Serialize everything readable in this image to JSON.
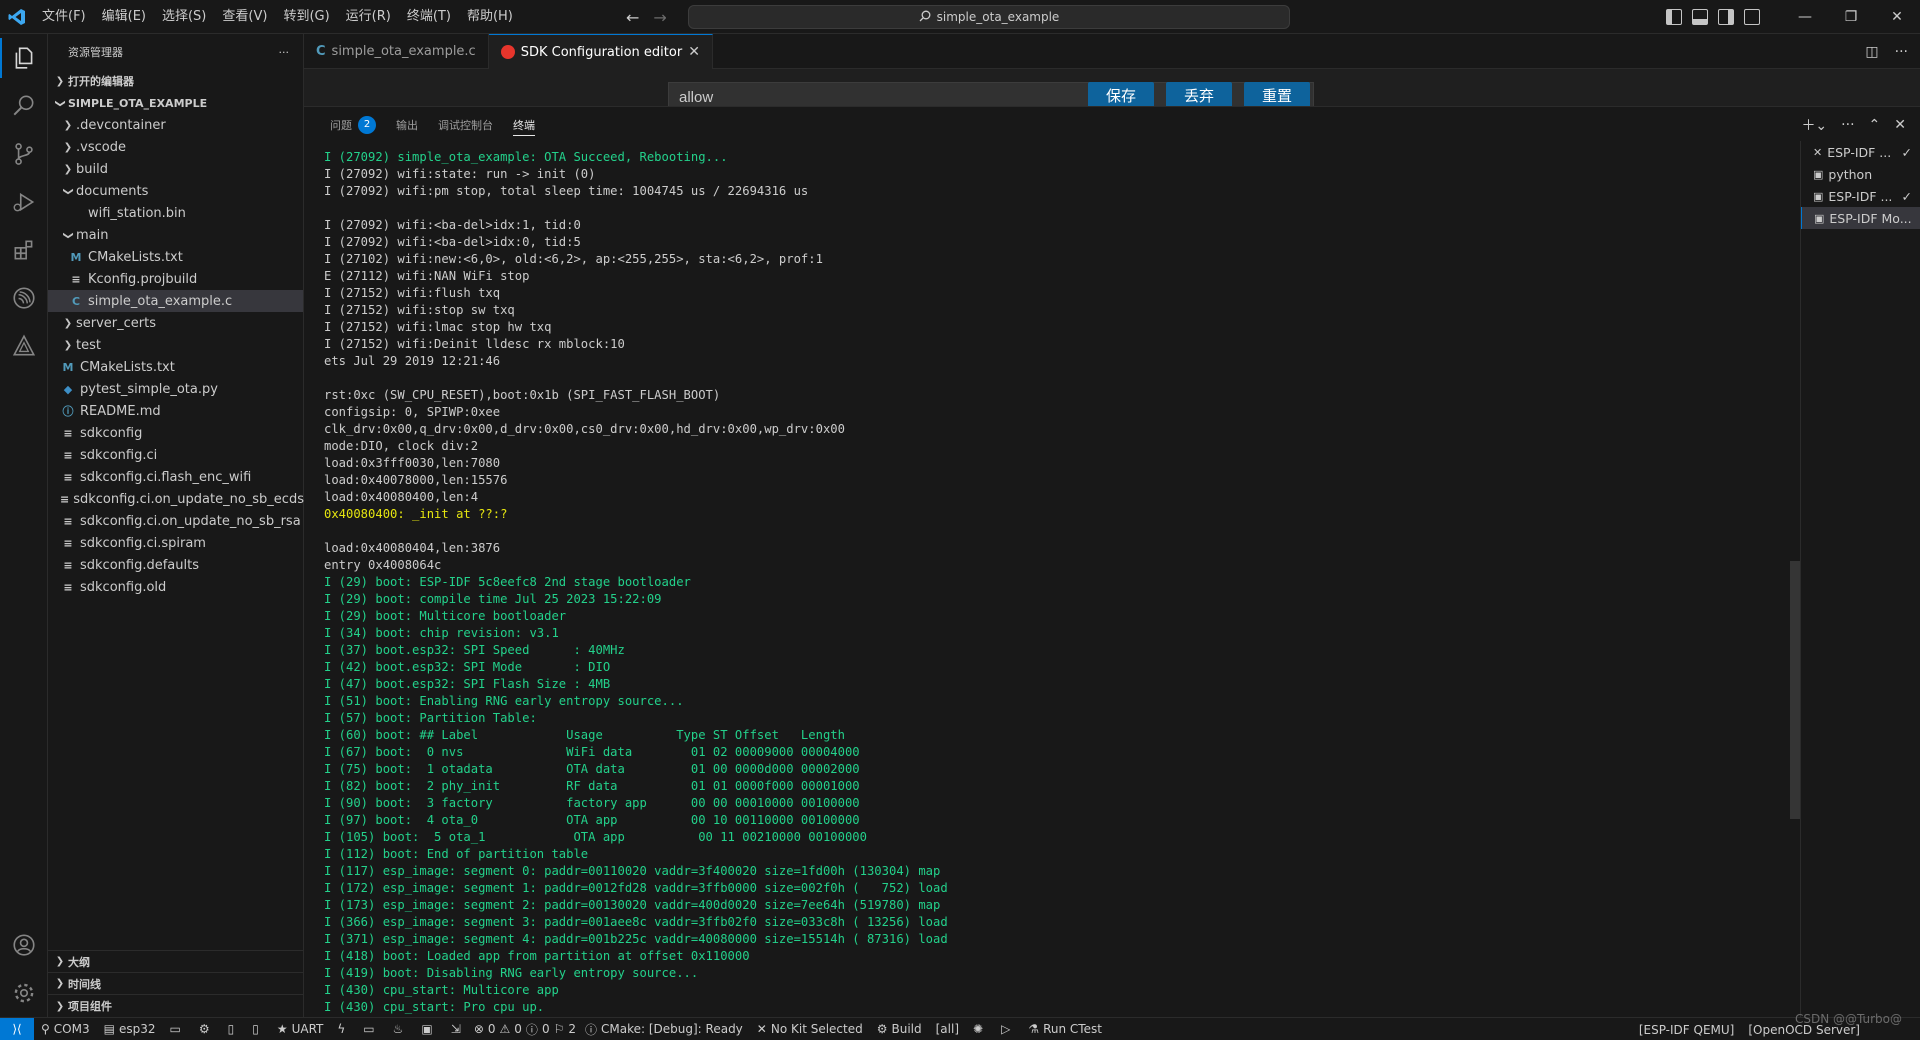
{
  "window": {
    "menu": [
      "文件(F)",
      "编辑(E)",
      "选择(S)",
      "查看(V)",
      "转到(G)",
      "运行(R)",
      "终端(T)",
      "帮助(H)"
    ],
    "search_text": "simple_ota_example"
  },
  "sidebar": {
    "title": "资源管理器",
    "open_editors": "打开的编辑器",
    "project": "SIMPLE_OTA_EXAMPLE",
    "tree": [
      {
        "label": ".devcontainer",
        "icon": "folder-collapsed-icon",
        "indent": 1
      },
      {
        "label": ".vscode",
        "icon": "folder-collapsed-icon",
        "indent": 1
      },
      {
        "label": "build",
        "icon": "folder-collapsed-icon",
        "indent": 1
      },
      {
        "label": "documents",
        "icon": "folder-expanded-icon",
        "indent": 1
      },
      {
        "label": "wifi_station.bin",
        "icon": "file-icon",
        "indent": 2
      },
      {
        "label": "main",
        "icon": "folder-expanded-icon",
        "indent": 1
      },
      {
        "label": "CMakeLists.txt",
        "icon": "cmake-file-icon",
        "indent": 2
      },
      {
        "label": "Kconfig.projbuild",
        "icon": "file-lines-icon",
        "indent": 2
      },
      {
        "label": "simple_ota_example.c",
        "icon": "c-file-icon",
        "indent": 2,
        "selected": true
      },
      {
        "label": "server_certs",
        "icon": "folder-collapsed-icon",
        "indent": 1
      },
      {
        "label": "test",
        "icon": "folder-collapsed-icon",
        "indent": 1
      },
      {
        "label": "CMakeLists.txt",
        "icon": "cmake-file-icon",
        "indent": 1
      },
      {
        "label": "pytest_simple_ota.py",
        "icon": "python-file-icon",
        "indent": 1
      },
      {
        "label": "README.md",
        "icon": "info-file-icon",
        "indent": 1
      },
      {
        "label": "sdkconfig",
        "icon": "file-lines-icon",
        "indent": 1
      },
      {
        "label": "sdkconfig.ci",
        "icon": "file-lines-icon",
        "indent": 1
      },
      {
        "label": "sdkconfig.ci.flash_enc_wifi",
        "icon": "file-lines-icon",
        "indent": 1
      },
      {
        "label": "sdkconfig.ci.on_update_no_sb_ecdsa",
        "icon": "file-lines-icon",
        "indent": 1
      },
      {
        "label": "sdkconfig.ci.on_update_no_sb_rsa",
        "icon": "file-lines-icon",
        "indent": 1
      },
      {
        "label": "sdkconfig.ci.spiram",
        "icon": "file-lines-icon",
        "indent": 1
      },
      {
        "label": "sdkconfig.defaults",
        "icon": "file-lines-icon",
        "indent": 1
      },
      {
        "label": "sdkconfig.old",
        "icon": "file-lines-icon",
        "indent": 1
      }
    ],
    "bottom_sections": [
      "大纲",
      "时间线",
      "项目组件"
    ]
  },
  "editor": {
    "tabs": [
      {
        "label": "simple_ota_example.c",
        "icon": "c-file-icon",
        "active": false
      },
      {
        "label": "SDK Configuration editor",
        "icon": "espressif-icon",
        "active": true
      }
    ],
    "sdk_input_value": "allow",
    "buttons": {
      "save": "保存",
      "discard": "丢弃",
      "reset": "重置"
    }
  },
  "panel": {
    "tabs": [
      {
        "label": "问题",
        "badge": "2",
        "active": false
      },
      {
        "label": "输出",
        "active": false
      },
      {
        "label": "调试控制台",
        "active": false
      },
      {
        "label": "终端",
        "active": true
      }
    ],
    "terminal_lines": [
      {
        "t": "I (27092) simple_ota_example: OTA Succeed, Rebooting...",
        "c": "green"
      },
      {
        "t": "I (27092) wifi:state: run -> init (0)",
        "c": "white"
      },
      {
        "t": "I (27092) wifi:pm stop, total sleep time: 1004745 us / 22694316 us",
        "c": "white"
      },
      {
        "t": "",
        "c": "white"
      },
      {
        "t": "I (27092) wifi:<ba-del>idx:1, tid:0",
        "c": "white"
      },
      {
        "t": "I (27092) wifi:<ba-del>idx:0, tid:5",
        "c": "white"
      },
      {
        "t": "I (27102) wifi:new:<6,0>, old:<6,2>, ap:<255,255>, sta:<6,2>, prof:1",
        "c": "white"
      },
      {
        "t": "E (27112) wifi:NAN WiFi stop",
        "c": "white"
      },
      {
        "t": "I (27152) wifi:flush txq",
        "c": "white"
      },
      {
        "t": "I (27152) wifi:stop sw txq",
        "c": "white"
      },
      {
        "t": "I (27152) wifi:lmac stop hw txq",
        "c": "white"
      },
      {
        "t": "I (27152) wifi:Deinit lldesc rx mblock:10",
        "c": "white"
      },
      {
        "t": "ets Jul 29 2019 12:21:46",
        "c": "white"
      },
      {
        "t": "",
        "c": "white"
      },
      {
        "t": "rst:0xc (SW_CPU_RESET),boot:0x1b (SPI_FAST_FLASH_BOOT)",
        "c": "white"
      },
      {
        "t": "configsip: 0, SPIWP:0xee",
        "c": "white"
      },
      {
        "t": "clk_drv:0x00,q_drv:0x00,d_drv:0x00,cs0_drv:0x00,hd_drv:0x00,wp_drv:0x00",
        "c": "white"
      },
      {
        "t": "mode:DIO, clock div:2",
        "c": "white"
      },
      {
        "t": "load:0x3fff0030,len:7080",
        "c": "white"
      },
      {
        "t": "load:0x40078000,len:15576",
        "c": "white"
      },
      {
        "t": "load:0x40080400,len:4",
        "c": "white"
      },
      {
        "t": "0x40080400: _init at ??:?",
        "c": "yellow"
      },
      {
        "t": "",
        "c": "white"
      },
      {
        "t": "load:0x40080404,len:3876",
        "c": "white"
      },
      {
        "t": "entry 0x4008064c",
        "c": "white"
      },
      {
        "t": "I (29) boot: ESP-IDF 5c8eefc8 2nd stage bootloader",
        "c": "green"
      },
      {
        "t": "I (29) boot: compile time Jul 25 2023 15:22:09",
        "c": "green"
      },
      {
        "t": "I (29) boot: Multicore bootloader",
        "c": "green"
      },
      {
        "t": "I (34) boot: chip revision: v3.1",
        "c": "green"
      },
      {
        "t": "I (37) boot.esp32: SPI Speed      : 40MHz",
        "c": "green"
      },
      {
        "t": "I (42) boot.esp32: SPI Mode       : DIO",
        "c": "green"
      },
      {
        "t": "I (47) boot.esp32: SPI Flash Size : 4MB",
        "c": "green"
      },
      {
        "t": "I (51) boot: Enabling RNG early entropy source...",
        "c": "green"
      },
      {
        "t": "I (57) boot: Partition Table:",
        "c": "green"
      },
      {
        "t": "I (60) boot: ## Label            Usage          Type ST Offset   Length",
        "c": "green"
      },
      {
        "t": "I (67) boot:  0 nvs              WiFi data        01 02 00009000 00004000",
        "c": "green"
      },
      {
        "t": "I (75) boot:  1 otadata          OTA data         01 00 0000d000 00002000",
        "c": "green"
      },
      {
        "t": "I (82) boot:  2 phy_init         RF data          01 01 0000f000 00001000",
        "c": "green"
      },
      {
        "t": "I (90) boot:  3 factory          factory app      00 00 00010000 00100000",
        "c": "green"
      },
      {
        "t": "I (97) boot:  4 ota_0            OTA app          00 10 00110000 00100000",
        "c": "green"
      },
      {
        "t": "I (105) boot:  5 ota_1            OTA app          00 11 00210000 00100000",
        "c": "green"
      },
      {
        "t": "I (112) boot: End of partition table",
        "c": "green"
      },
      {
        "t": "I (117) esp_image: segment 0: paddr=00110020 vaddr=3f400020 size=1fd00h (130304) map",
        "c": "green"
      },
      {
        "t": "I (172) esp_image: segment 1: paddr=0012fd28 vaddr=3ffb0000 size=002f0h (   752) load",
        "c": "green"
      },
      {
        "t": "I (173) esp_image: segment 2: paddr=00130020 vaddr=400d0020 size=7ee64h (519780) map",
        "c": "green"
      },
      {
        "t": "I (366) esp_image: segment 3: paddr=001aee8c vaddr=3ffb02f0 size=033c8h ( 13256) load",
        "c": "green"
      },
      {
        "t": "I (371) esp_image: segment 4: paddr=001b225c vaddr=40080000 size=15514h ( 87316) load",
        "c": "green"
      },
      {
        "t": "I (418) boot: Loaded app from partition at offset 0x110000",
        "c": "green"
      },
      {
        "t": "I (419) boot: Disabling RNG early entropy source...",
        "c": "green"
      },
      {
        "t": "I (430) cpu_start: Multicore app",
        "c": "green"
      },
      {
        "t": "I (430) cpu_start: Pro cpu up.",
        "c": "green"
      }
    ],
    "terminal_list": [
      {
        "label": "ESP-IDF ...",
        "icon": "tools-icon",
        "check": true
      },
      {
        "label": "python",
        "icon": "terminal-icon",
        "check": false
      },
      {
        "label": "ESP-IDF ...",
        "icon": "terminal-icon",
        "check": true
      },
      {
        "label": "ESP-IDF Mo...",
        "icon": "terminal-icon",
        "check": false,
        "active": true
      }
    ]
  },
  "statusbar": {
    "left": [
      {
        "label": "COM3",
        "icon": "plug-icon"
      },
      {
        "label": "esp32",
        "icon": "chip-icon"
      },
      {
        "label": "",
        "icon": "folder-icon"
      },
      {
        "label": "",
        "icon": "gear-icon"
      },
      {
        "label": "",
        "icon": "trash-icon"
      },
      {
        "label": "",
        "icon": "database-icon"
      },
      {
        "label": "UART",
        "icon": "star-icon"
      },
      {
        "label": "",
        "icon": "flash-icon"
      },
      {
        "label": "",
        "icon": "monitor-icon"
      },
      {
        "label": "",
        "icon": "flame-icon"
      },
      {
        "label": "",
        "icon": "terminal-icon"
      },
      {
        "label": "",
        "icon": "export-icon"
      },
      {
        "label": "0",
        "icon": "error-icon"
      },
      {
        "label": "0",
        "icon": "warning-icon"
      },
      {
        "label": "0",
        "icon": "info-icon"
      },
      {
        "label": "2",
        "icon": "bell-icon"
      },
      {
        "label": "CMake: [Debug]: Ready",
        "icon": "info-circle-icon"
      },
      {
        "label": "No Kit Selected",
        "icon": "tools-icon"
      },
      {
        "label": "Build",
        "icon": "gear-icon"
      },
      {
        "label": "[all]",
        "icon": ""
      },
      {
        "label": "",
        "icon": "bug-icon"
      },
      {
        "label": "",
        "icon": "play-icon"
      },
      {
        "label": "Run CTest",
        "icon": "flask-icon"
      }
    ],
    "right": [
      "[ESP-IDF QEMU]",
      "[OpenOCD Server]"
    ],
    "watermark": "CSDN @@Turbo@"
  }
}
